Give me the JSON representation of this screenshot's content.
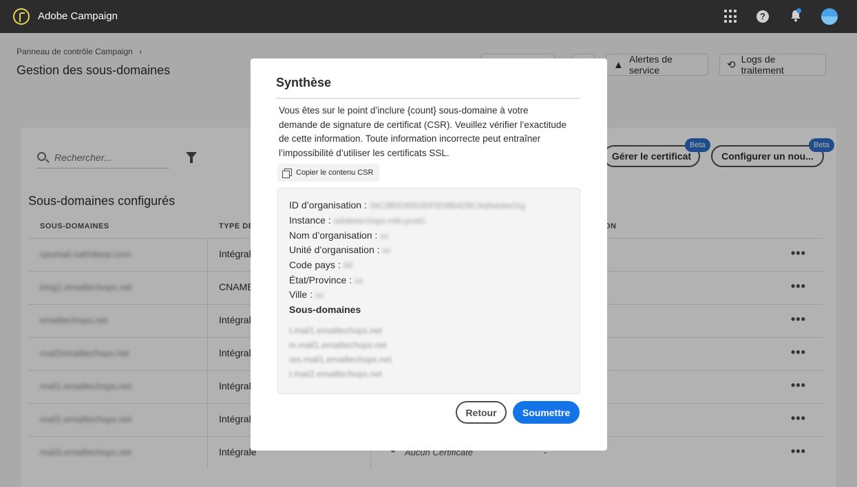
{
  "app": {
    "title": "Adobe Campaign"
  },
  "header": {
    "breadcrumb": "Panneau de contrôle Campaign",
    "breadcrumb_sep": "›",
    "page_title": "Gestion des sous-domaines",
    "buttons": [
      {
        "label": "",
        "icon": "blank"
      },
      {
        "label": "",
        "icon": "blank"
      },
      {
        "label": "Alertes de service",
        "icon": "warning-icon"
      },
      {
        "label": "Logs de traitement",
        "icon": "history-icon"
      }
    ]
  },
  "toolbar": {
    "search_placeholder": "Rechercher...",
    "manage_cert_label": "Gérer le certificat",
    "configure_label": "Configurer un nou...",
    "beta_label": "Beta"
  },
  "table": {
    "title": "Sous-domaines configurés",
    "columns": [
      "SOUS-DOMAINES",
      "TYPE DE",
      "ON"
    ],
    "rows": [
      {
        "name": "cpumail.sakhibear.com",
        "type": "Intégral"
      },
      {
        "name": "blog1.emailtechops.net",
        "type": "CNAME"
      },
      {
        "name": "emailtechops.net",
        "type": "Intégrale"
      },
      {
        "name": "mail2emailtechops.net",
        "type": "Intégrale"
      },
      {
        "name": "mail1.emailtechops.net",
        "type": "Intégrale"
      },
      {
        "name": "mail2.emailtechops.net",
        "type": "Intégrale"
      },
      {
        "name": "mail3.emailtechops.net",
        "type": "Intégrale",
        "cert": "Aucun Certificate",
        "extra": "-"
      }
    ]
  },
  "modal": {
    "title": "Synthèse",
    "description_lines": [
      "Vous êtes sur le point d’inclure {count} sous-domaine à votre",
      "demande de signature de certificat (CSR).  Veuillez vérifier l’exactitude",
      "de cette information. Toute information incorrecte  peut entraîner",
      "l’impossibilité d’utiliser les  certificats SSL."
    ],
    "copy_label": "Copier le contenu CSR",
    "fields": [
      {
        "label": "ID d’organisation :",
        "value": "34C3B0D6553DF5D9BAD9CAdAdobeOrg"
      },
      {
        "label": "Instance :",
        "value": "adobetechops-mkt-prod1"
      },
      {
        "label": "Nom d’organisation :",
        "value": "xx"
      },
      {
        "label": "Unité d’organisation :",
        "value": "xx"
      },
      {
        "label": "Code pays :",
        "value": "AF"
      },
      {
        "label": "État/Province :",
        "value": "xx"
      },
      {
        "label": "Ville :",
        "value": "xx"
      }
    ],
    "subdomains_title": "Sous-domaines",
    "subdomains": [
      "t.mail1.emailtechops.net",
      "m.mail1.emailtechops.net",
      "res.mail1.emailtechops.net",
      "t.mail2.emailtechops.net"
    ],
    "back_label": "Retour",
    "submit_label": "Soumettre"
  },
  "colors": {
    "accent": "#1473e6",
    "topbar": "#2c2c2c",
    "beta": "#2d6fc9"
  }
}
